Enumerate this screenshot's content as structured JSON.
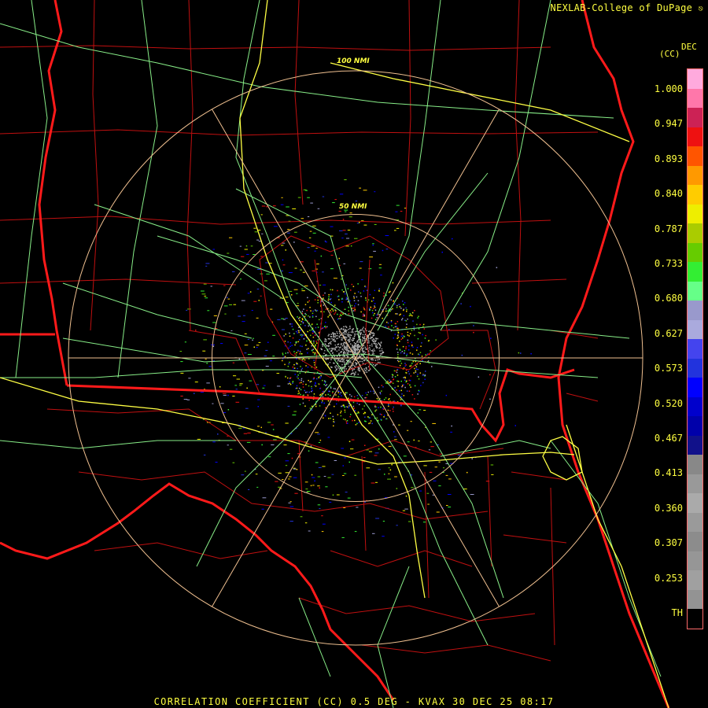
{
  "header": {
    "source": "NEXLAB-College of DuPage",
    "logo_icon": "cod-logo-icon"
  },
  "footer": {
    "product_line": "CORRELATION COEFFICIENT (CC) 0.5 DEG - KVAX 30 DEC 25 08:17"
  },
  "legend": {
    "product_id": "DEC",
    "unit": "(CC)",
    "labels": [
      "1.000",
      "0.947",
      "0.893",
      "0.840",
      "0.787",
      "0.733",
      "0.680",
      "0.627",
      "0.573",
      "0.520",
      "0.467",
      "0.413",
      "0.360",
      "0.307",
      "0.253",
      "TH"
    ],
    "colors": [
      "#ffaadd",
      "#ff77aa",
      "#cc2255",
      "#ee1111",
      "#ff5500",
      "#ff9900",
      "#ffcc00",
      "#eeee00",
      "#aacc00",
      "#66cc00",
      "#33ee33",
      "#66ff88",
      "#9999cc",
      "#aaaadd",
      "#4444ee",
      "#2233dd",
      "#0000ff",
      "#0000cc",
      "#0000aa",
      "#11118a",
      "#888888",
      "#999999",
      "#aaaaaa",
      "#9a9a9a",
      "#8c8c8c",
      "#969696",
      "#a0a0a0",
      "#939393",
      "#000000"
    ]
  },
  "range_rings": [
    {
      "label": "50 NMI",
      "range_nmi": 50
    },
    {
      "label": "100 NMI",
      "range_nmi": 100
    }
  ],
  "map_colors": {
    "state_border": "#ff1a1a",
    "county_border": "#c01010",
    "highway": "#ffff44",
    "road": "#88ee88",
    "range_ring": "#f0c090"
  },
  "radar": {
    "site": "KVAX"
  }
}
